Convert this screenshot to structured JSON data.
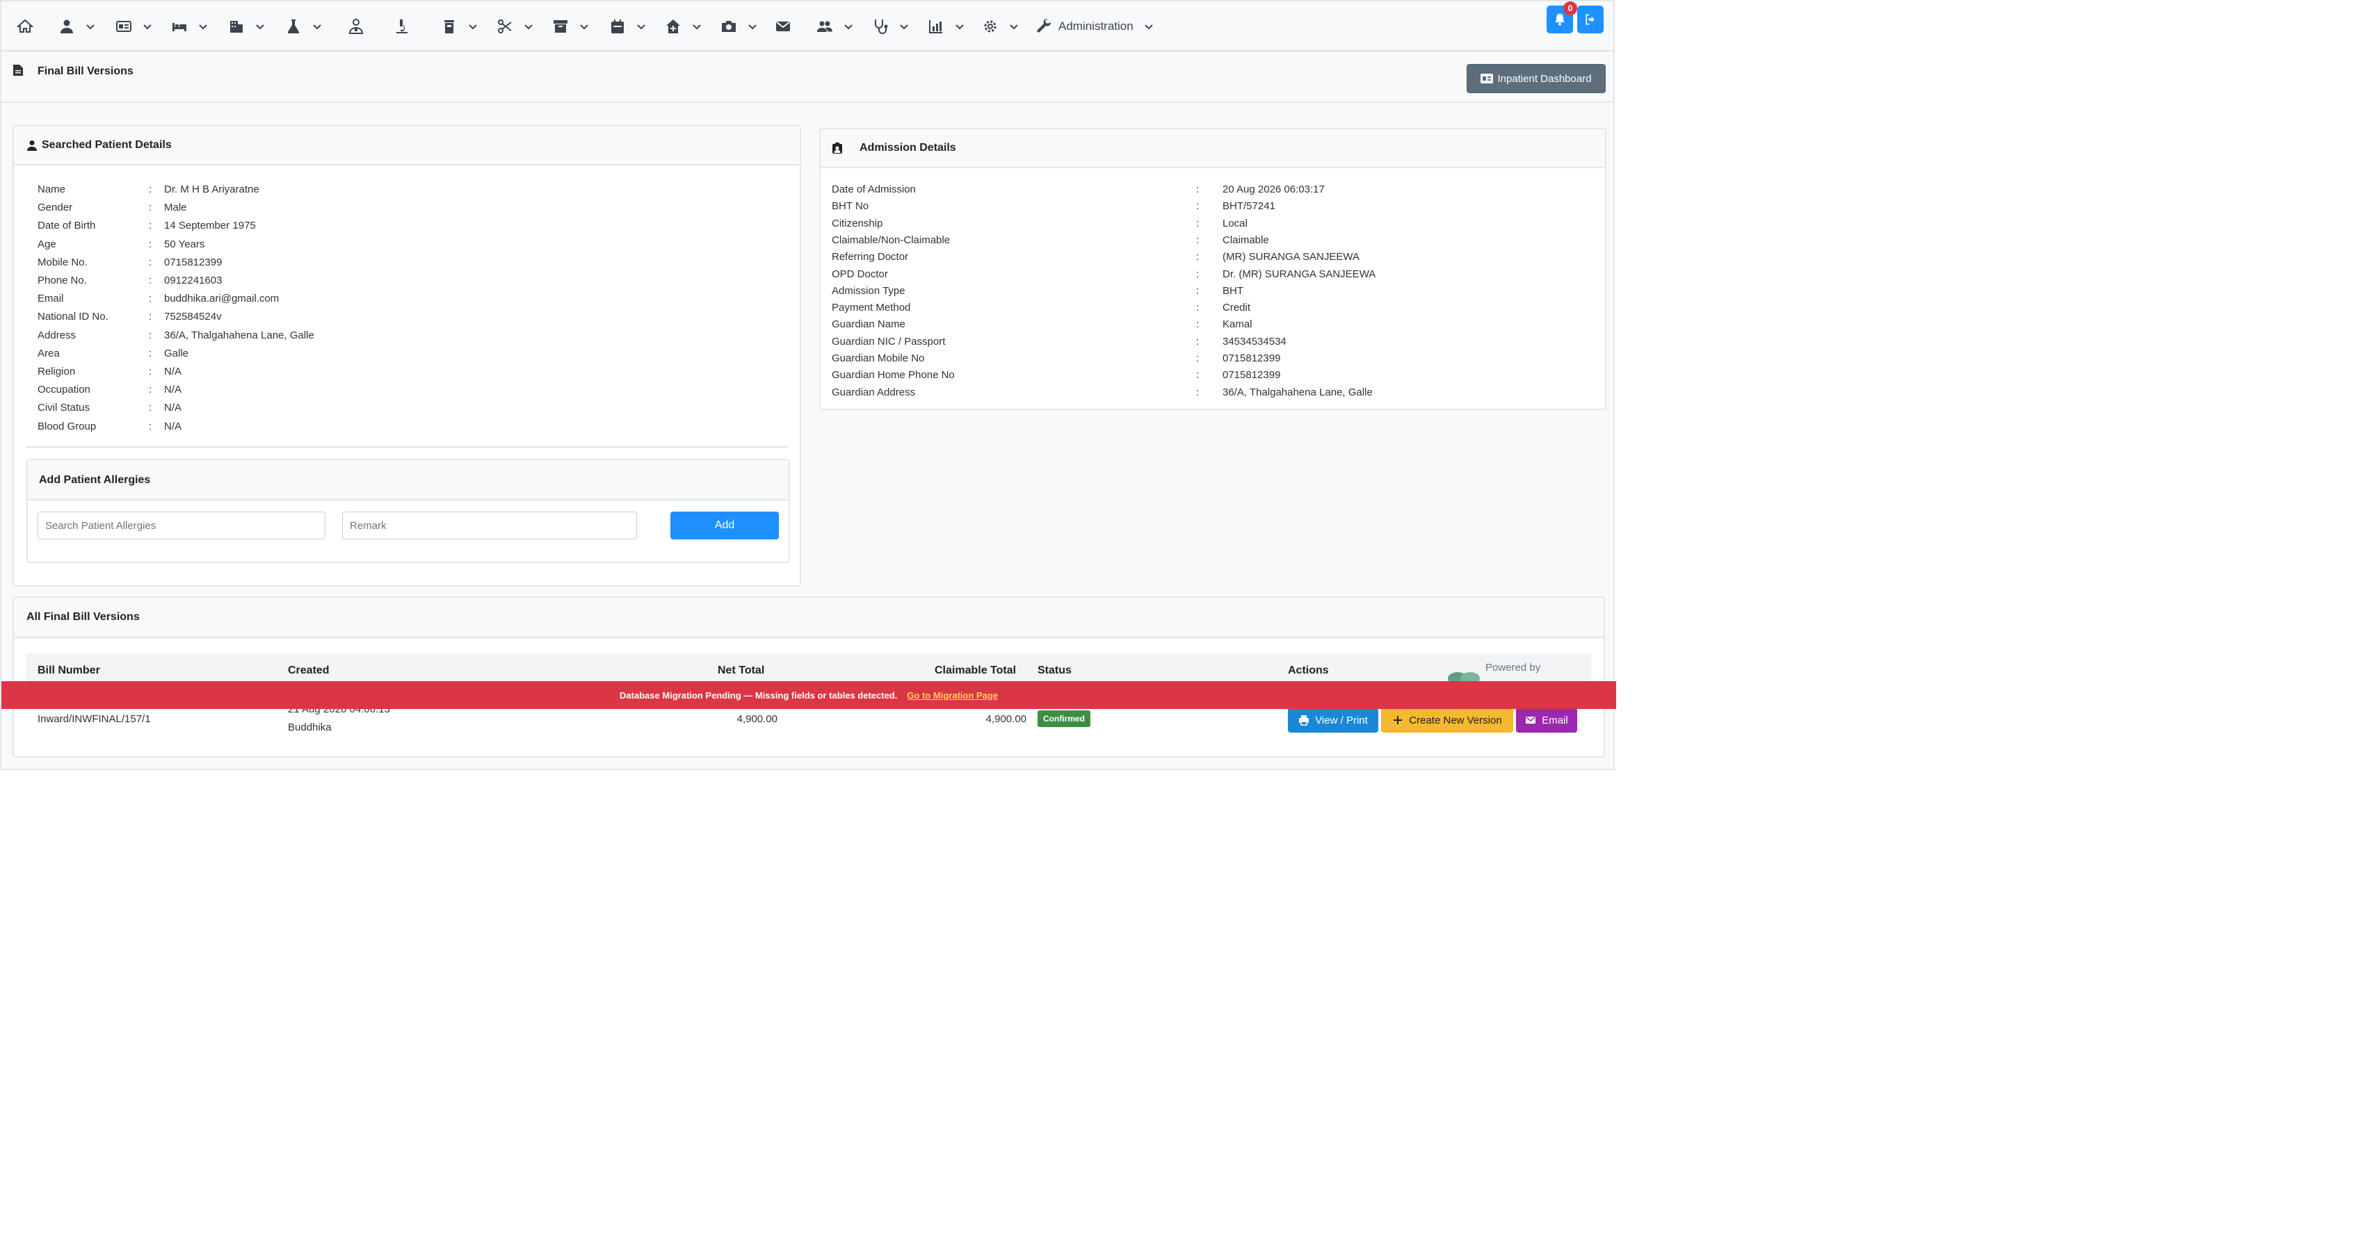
{
  "navbar": {
    "items": [
      {
        "icon": "home-icon",
        "has_caret": false
      },
      {
        "icon": "user-icon",
        "has_caret": true
      },
      {
        "icon": "id-card-icon",
        "has_caret": true
      },
      {
        "icon": "bed-icon",
        "has_caret": true
      },
      {
        "icon": "building-icon",
        "has_caret": true
      },
      {
        "icon": "flask-icon",
        "has_caret": true
      },
      {
        "icon": "user-doctor-icon",
        "has_caret": false
      },
      {
        "icon": "microscope-icon",
        "has_caret": false
      },
      {
        "icon": "trash-bin-icon",
        "has_caret": true
      },
      {
        "icon": "scissors-icon",
        "has_caret": true
      },
      {
        "icon": "archive-icon",
        "has_caret": true
      },
      {
        "icon": "calendar-icon",
        "has_caret": true
      },
      {
        "icon": "house-medical-icon",
        "has_caret": true
      },
      {
        "icon": "camera-icon",
        "has_caret": true
      },
      {
        "icon": "envelope-icon",
        "has_caret": false
      },
      {
        "icon": "users-icon",
        "has_caret": true
      },
      {
        "icon": "stethoscope-icon",
        "has_caret": true
      },
      {
        "icon": "chart-icon",
        "has_caret": true
      },
      {
        "icon": "gear-icon",
        "has_caret": true
      }
    ],
    "administration_label": "Administration",
    "notification_count": "0"
  },
  "page": {
    "title": "Final Bill Versions",
    "dashboard_button": "Inpatient Dashboard"
  },
  "patient": {
    "header": "Searched Patient Details",
    "rows": [
      {
        "label": "Name",
        "value": "Dr. M H B Ariyaratne"
      },
      {
        "label": "Gender",
        "value": "Male"
      },
      {
        "label": "Date of Birth",
        "value": "14 September 1975"
      },
      {
        "label": "Age",
        "value": "50 Years"
      },
      {
        "label": "Mobile No.",
        "value": "0715812399"
      },
      {
        "label": "Phone No.",
        "value": "0912241603"
      },
      {
        "label": "Email",
        "value": "buddhika.ari@gmail.com"
      },
      {
        "label": "National ID No.",
        "value": "752584524v"
      },
      {
        "label": "Address",
        "value": "36/A, Thalgahahena Lane, Galle"
      },
      {
        "label": "Area",
        "value": "Galle"
      },
      {
        "label": "Religion",
        "value": "N/A"
      },
      {
        "label": "Occupation",
        "value": "N/A"
      },
      {
        "label": "Civil Status",
        "value": "N/A"
      },
      {
        "label": "Blood Group",
        "value": "N/A"
      }
    ],
    "separator": ":"
  },
  "allergies": {
    "header": "Add Patient Allergies",
    "search_placeholder": "Search Patient Allergies",
    "remark_placeholder": "Remark",
    "add_button": "Add"
  },
  "admission": {
    "header": "Admission Details",
    "rows": [
      {
        "label": "Date of Admission",
        "value": "20 Aug 2026 06:03:17"
      },
      {
        "label": "BHT No",
        "value": "BHT/57241"
      },
      {
        "label": "Citizenship",
        "value": "Local"
      },
      {
        "label": "Claimable/Non-Claimable",
        "value": "Claimable"
      },
      {
        "label": "Referring Doctor",
        "value": "(MR) SURANGA SANJEEWA"
      },
      {
        "label": "OPD Doctor",
        "value": "Dr. (MR) SURANGA SANJEEWA"
      },
      {
        "label": "Admission Type",
        "value": "BHT"
      },
      {
        "label": "Payment Method",
        "value": "Credit"
      },
      {
        "label": "Guardian Name",
        "value": "Kamal"
      },
      {
        "label": "Guardian NIC / Passport",
        "value": "34534534534"
      },
      {
        "label": "Guardian Mobile No",
        "value": "0715812399"
      },
      {
        "label": "Guardian Home Phone No",
        "value": "0715812399"
      },
      {
        "label": "Guardian Address",
        "value": "36/A, Thalgahahena Lane, Galle"
      }
    ]
  },
  "bills": {
    "header": "All Final Bill Versions",
    "columns": {
      "bill_number": "Bill Number",
      "created": "Created",
      "net_total": "Net Total",
      "claimable_total": "Claimable Total",
      "status": "Status",
      "actions": "Actions"
    },
    "rows": [
      {
        "bill_number": "Inward/INWFINAL/157/1",
        "created_date": "21 Aug 2026 04:06:13",
        "created_by": "Buddhika",
        "net_total": "4,900.00",
        "claimable_total": "4,900.00",
        "status": "Confirmed",
        "actions": {
          "view": "View / Print",
          "create": "Create New Version",
          "email": "Email"
        }
      }
    ]
  },
  "banner": {
    "message": "Database Migration Pending — Missing fields or tables detected.",
    "link": "Go to Migration Page"
  },
  "powered_by": "Powered by",
  "colors": {
    "primary": "#1e90ff",
    "danger": "#dc3545",
    "success": "#3e8e41",
    "warning": "#f5b82e",
    "purple": "#9c27b0",
    "info_blue": "#1a88d6",
    "secondary": "#5c6d7c"
  }
}
